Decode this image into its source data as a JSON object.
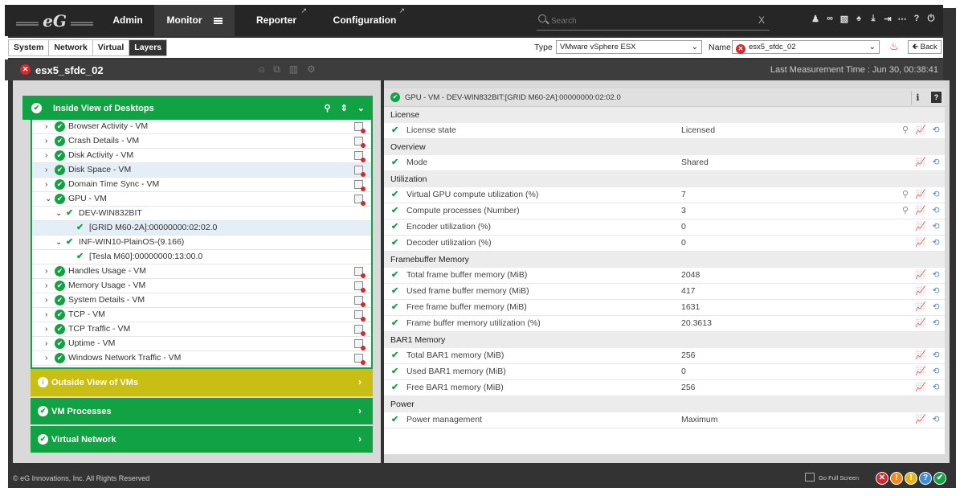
{
  "nav": {
    "logo": "eG",
    "items": [
      {
        "label": "Admin"
      },
      {
        "label": "Monitor"
      },
      {
        "label": "Reporter"
      },
      {
        "label": "Configuration"
      }
    ],
    "search_placeholder": "Search",
    "search_clear": "X"
  },
  "subbar": {
    "view_tabs": [
      "System",
      "Network",
      "Virtual",
      "Layers"
    ],
    "active_tab": "Layers",
    "type_label": "Type",
    "type_value": "VMware vSphere ESX",
    "name_label": "Name",
    "name_value": "esx5_sfdc_02",
    "back_label": "Back"
  },
  "component": {
    "name": "esx5_sfdc_02",
    "last_measurement": "Last Measurement Time : Jun 30, 00:38:41"
  },
  "left": {
    "inside_title": "Inside View of Desktops",
    "tests": [
      {
        "label": "Browser Activity - VM"
      },
      {
        "label": "Crash Details - VM"
      },
      {
        "label": "Disk Activity - VM"
      },
      {
        "label": "Disk Space - VM"
      },
      {
        "label": "Domain Time Sync - VM"
      },
      {
        "label": "GPU - VM"
      },
      {
        "label": "DEV-WIN832BIT"
      },
      {
        "label": "[GRID M60-2A]:00000000:02:02.0"
      },
      {
        "label": "INF-WIN10-PlainOS-(9.166)"
      },
      {
        "label": "[Tesla M60]:00000000:13:00.0"
      },
      {
        "label": "Handles Usage - VM"
      },
      {
        "label": "Memory Usage - VM"
      },
      {
        "label": "System Details - VM"
      },
      {
        "label": "TCP - VM"
      },
      {
        "label": "TCP Traffic - VM"
      },
      {
        "label": "Uptime - VM"
      },
      {
        "label": "Windows Network Traffic - VM"
      }
    ],
    "outside_title": "Outside View of VMs",
    "processes_title": "VM Processes",
    "network_title": "Virtual Network"
  },
  "right": {
    "header": "GPU - VM - DEV-WIN832BIT:[GRID M60-2A]:00000000:02:02.0",
    "groups": [
      {
        "title": "License",
        "rows": [
          {
            "name": "License state",
            "value": "Licensed"
          }
        ]
      },
      {
        "title": "Overview",
        "rows": [
          {
            "name": "Mode",
            "value": "Shared"
          }
        ]
      },
      {
        "title": "Utilization",
        "rows": [
          {
            "name": "Virtual GPU compute utilization (%)",
            "value": "7"
          },
          {
            "name": "Compute processes (Number)",
            "value": "3"
          },
          {
            "name": "Encoder utilization (%)",
            "value": "0"
          },
          {
            "name": "Decoder utilization (%)",
            "value": "0"
          }
        ]
      },
      {
        "title": "Framebuffer Memory",
        "rows": [
          {
            "name": "Total frame buffer memory (MiB)",
            "value": "2048"
          },
          {
            "name": "Used frame buffer memory (MiB)",
            "value": "417"
          },
          {
            "name": "Free frame buffer memory (MiB)",
            "value": "1631"
          },
          {
            "name": "Frame buffer memory utilization (%)",
            "value": "20.3613"
          }
        ]
      },
      {
        "title": "BAR1 Memory",
        "rows": [
          {
            "name": "Total BAR1 memory (MiB)",
            "value": "256"
          },
          {
            "name": "Used BAR1 memory (MiB)",
            "value": "0"
          },
          {
            "name": "Free BAR1 memory (MiB)",
            "value": "256"
          }
        ]
      },
      {
        "title": "Power",
        "rows": [
          {
            "name": "Power management",
            "value": "Maximum"
          }
        ]
      }
    ]
  },
  "footer": {
    "copyright": "© eG Innovations, Inc. All Rights Reserved",
    "fullscreen": "Go Full Screen"
  },
  "colors": {
    "ok_green": "#11a243",
    "warn_yellow": "#c8be14",
    "critical_red": "#d7282d"
  }
}
